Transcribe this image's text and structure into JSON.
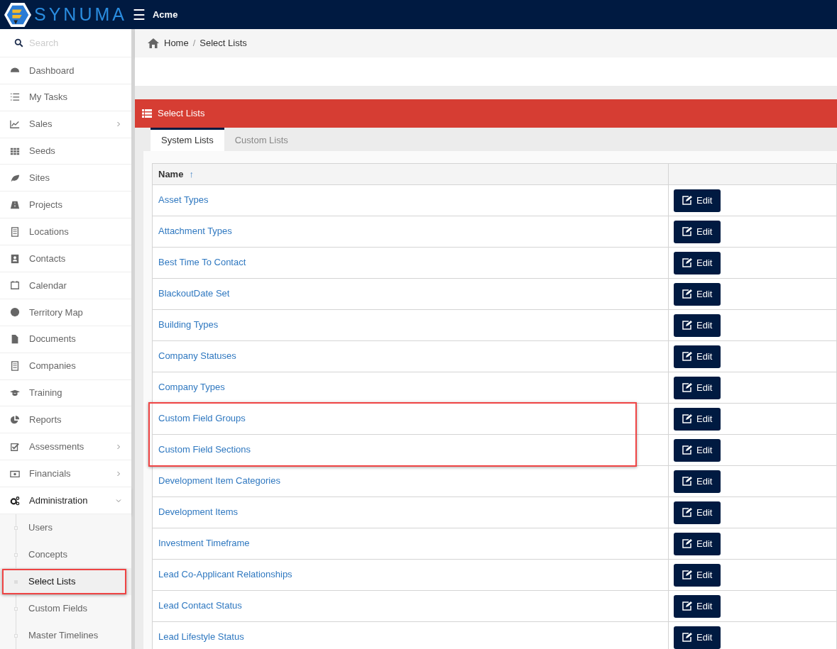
{
  "header": {
    "brand": "SYNUMA",
    "menu_glyph": "☰",
    "company": "Acme"
  },
  "sidebar": {
    "search": {
      "placeholder": "Search"
    },
    "items": [
      {
        "label": "Dashboard"
      },
      {
        "label": "My Tasks"
      },
      {
        "label": "Sales",
        "expanded": false
      },
      {
        "label": "Seeds"
      },
      {
        "label": "Sites"
      },
      {
        "label": "Projects"
      },
      {
        "label": "Locations"
      },
      {
        "label": "Contacts"
      },
      {
        "label": "Calendar"
      },
      {
        "label": "Territory Map"
      },
      {
        "label": "Documents"
      },
      {
        "label": "Companies"
      },
      {
        "label": "Training"
      },
      {
        "label": "Reports"
      },
      {
        "label": "Assessments",
        "expanded": false
      },
      {
        "label": "Financials",
        "expanded": false
      },
      {
        "label": "Administration",
        "expanded": true,
        "children": [
          {
            "label": "Users",
            "selected": false,
            "highlighted": false
          },
          {
            "label": "Concepts",
            "selected": false,
            "highlighted": false
          },
          {
            "label": "Select Lists",
            "selected": true,
            "highlighted": true
          },
          {
            "label": "Custom Fields",
            "selected": false,
            "highlighted": false
          },
          {
            "label": "Master Timelines",
            "selected": false,
            "highlighted": false
          }
        ]
      }
    ]
  },
  "breadcrumb": {
    "separator": "/",
    "items": [
      "Home",
      "Select Lists"
    ]
  },
  "panel": {
    "title": "Select Lists",
    "tabs": [
      {
        "label": "System Lists",
        "selected": true
      },
      {
        "label": "Custom Lists",
        "selected": false
      }
    ],
    "table": {
      "columns": [
        {
          "label": "Name",
          "sort_glyph": "↑"
        },
        {}
      ],
      "rows": [
        {
          "name": "Asset Types",
          "action": "Edit",
          "highlighted": false
        },
        {
          "name": "Attachment Types",
          "action": "Edit",
          "highlighted": false
        },
        {
          "name": "Best Time To Contact",
          "action": "Edit",
          "highlighted": false
        },
        {
          "name": "BlackoutDate Set",
          "action": "Edit",
          "highlighted": false
        },
        {
          "name": "Building Types",
          "action": "Edit",
          "highlighted": false
        },
        {
          "name": "Company Statuses",
          "action": "Edit",
          "highlighted": false
        },
        {
          "name": "Company Types",
          "action": "Edit",
          "highlighted": false
        },
        {
          "name": "Custom Field Groups",
          "action": "Edit",
          "highlighted": true
        },
        {
          "name": "Custom Field Sections",
          "action": "Edit",
          "highlighted": true
        },
        {
          "name": "Development Item Categories",
          "action": "Edit",
          "highlighted": false
        },
        {
          "name": "Development Items",
          "action": "Edit",
          "highlighted": false
        },
        {
          "name": "Investment Timeframe",
          "action": "Edit",
          "highlighted": false
        },
        {
          "name": "Lead Co-Applicant Relationships",
          "action": "Edit",
          "highlighted": false
        },
        {
          "name": "Lead Contact Status",
          "action": "Edit",
          "highlighted": false
        },
        {
          "name": "Lead Lifestyle Status",
          "action": "Edit",
          "highlighted": false
        }
      ]
    }
  }
}
